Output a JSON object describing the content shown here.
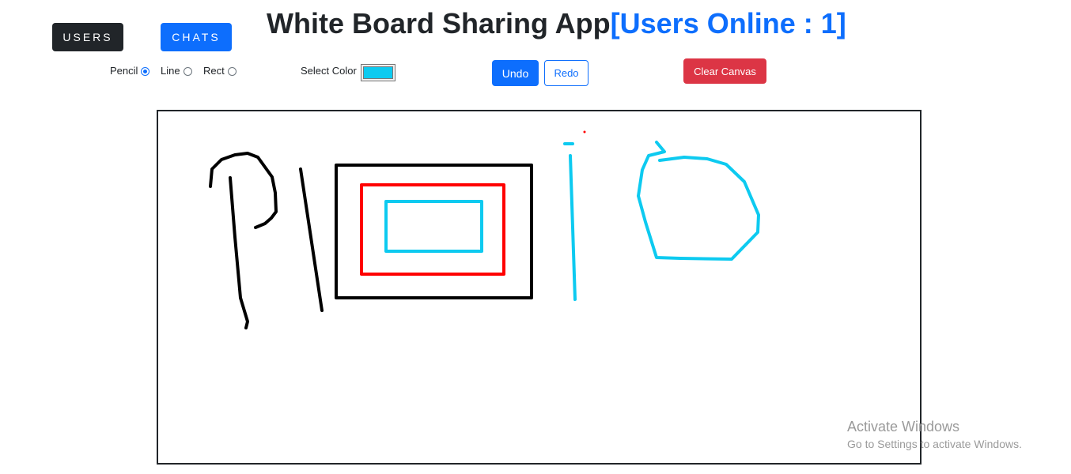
{
  "header": {
    "users_button": "USERS",
    "chats_button": "CHATS",
    "title": "White Board Sharing App",
    "online_text": "[Users Online : 1]"
  },
  "toolbar": {
    "tools": [
      {
        "label": "Pencil",
        "checked": true
      },
      {
        "label": "Line",
        "checked": false
      },
      {
        "label": "Rect",
        "checked": false
      }
    ],
    "color_label": "Select Color",
    "selected_color": "#0dcaf0",
    "undo_label": "Undo",
    "redo_label": "Redo",
    "clear_label": "Clear Canvas"
  },
  "watermark": {
    "title": "Activate Windows",
    "subtitle": "Go to Settings to activate Windows."
  },
  "colors": {
    "primary": "#0d6efd",
    "dark": "#212529",
    "danger": "#dc3545",
    "stroke_black": "#000000",
    "stroke_red": "#ff0000",
    "stroke_cyan": "#0dcaf0"
  }
}
